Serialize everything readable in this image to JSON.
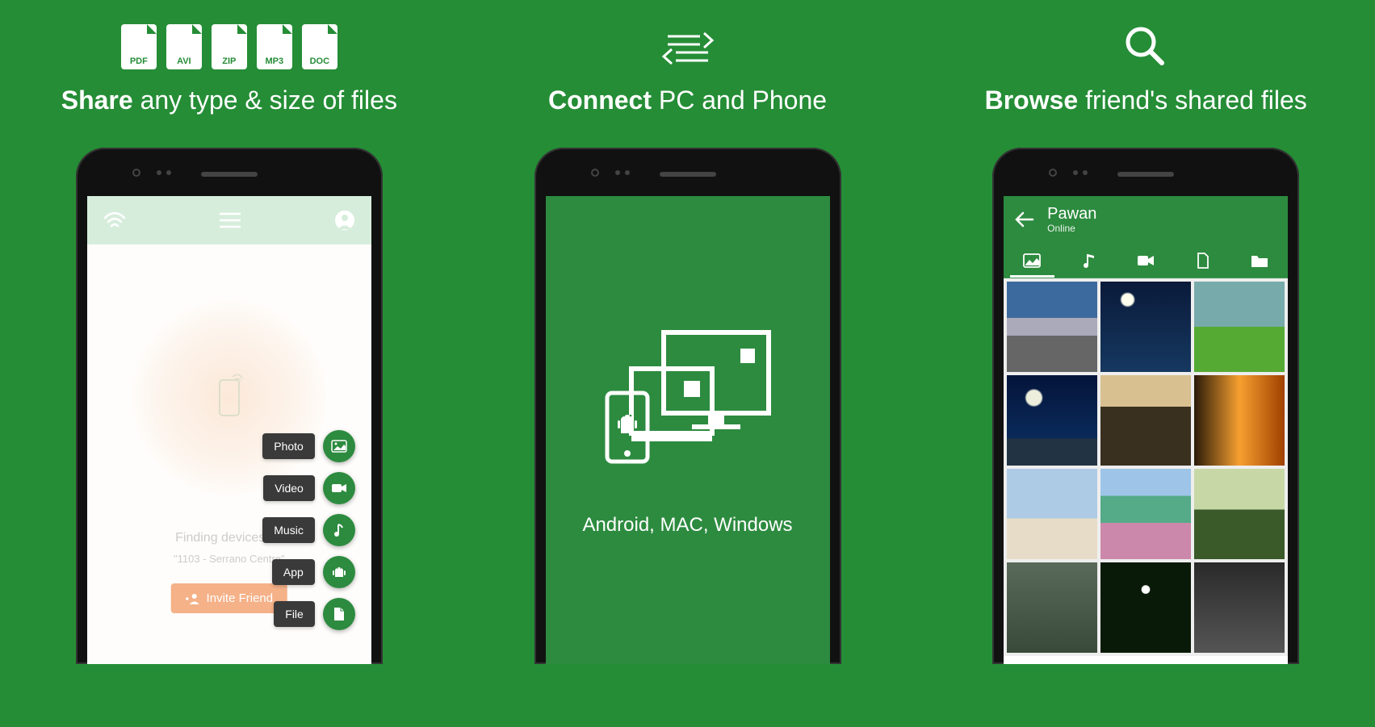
{
  "columns": {
    "share": {
      "file_types": [
        "PDF",
        "AVI",
        "ZIP",
        "MP3",
        "DOC"
      ],
      "headline_bold": "Share",
      "headline_rest": " any type & size of files"
    },
    "connect": {
      "headline_bold": "Connect",
      "headline_rest": " PC and Phone",
      "platforms_text": "Android, MAC, Windows"
    },
    "browse": {
      "headline_bold": "Browse",
      "headline_rest": " friend's shared files"
    }
  },
  "screen1": {
    "finding_text": "Finding devices on",
    "network_text": "\"1103 - Serrano Centre\"",
    "invite_label": "Invite Friend",
    "fab": [
      {
        "label": "Photo"
      },
      {
        "label": "Video"
      },
      {
        "label": "Music"
      },
      {
        "label": "App"
      },
      {
        "label": "File"
      }
    ]
  },
  "screen3": {
    "user_name": "Pawan",
    "status": "Online"
  }
}
